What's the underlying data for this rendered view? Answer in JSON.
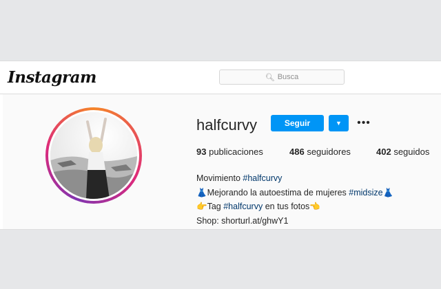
{
  "navbar": {
    "logo_text": "Instagram",
    "search": {
      "placeholder": "Busca",
      "icon": "search-icon"
    }
  },
  "profile": {
    "username": "halfcurvy",
    "follow_label": "Seguir",
    "dropdown_icon": "caret-down-icon",
    "more_icon": "more-horizontal-icon",
    "stats": {
      "posts_count": "93",
      "posts_label": "publicaciones",
      "followers_count": "486",
      "followers_label": "seguidores",
      "following_count": "402",
      "following_label": "seguidos"
    },
    "bio": {
      "line1_text": "Movimiento",
      "line1_tag": "#halfcurvy",
      "line2_text": "Mejorando la autoestima de mujeres",
      "line2_tag": "#midsize",
      "line3_prefix": "Tag",
      "line3_tag": "#halfcurvy",
      "line3_suffix": "en tus fotos",
      "line4_text": "Shop: shorturl.at/ghwY1"
    }
  },
  "colors": {
    "accent_blue": "#0095f6",
    "hashtag": "#00376b",
    "ring_start": "#f58529",
    "ring_mid": "#dd2a7b",
    "ring_end": "#8134af"
  }
}
